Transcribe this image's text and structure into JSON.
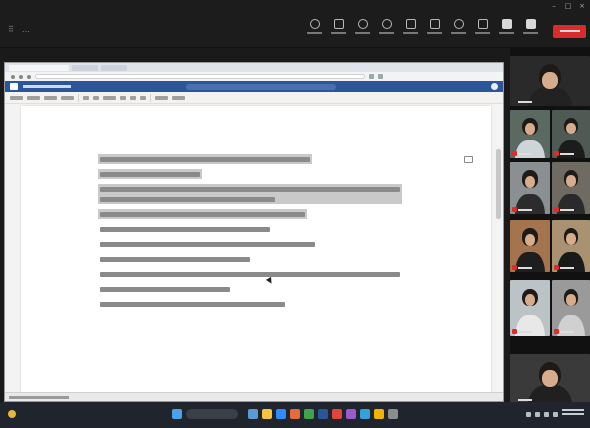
{
  "app": {
    "title": ""
  },
  "toolbar": {
    "tools": [
      {
        "id": "view"
      },
      {
        "id": "people"
      },
      {
        "id": "raise"
      },
      {
        "id": "react"
      },
      {
        "id": "view2"
      },
      {
        "id": "more"
      },
      {
        "id": "share"
      },
      {
        "id": "record"
      },
      {
        "id": "apps"
      },
      {
        "id": "more2"
      }
    ],
    "camera_label": "",
    "mic_label": "",
    "share_label": "",
    "leave_label": "",
    "leave_color": "#d92d2d"
  },
  "document": {
    "app_color": "#2b579a",
    "highlight_color": "#c9c9c9",
    "section_heading": "",
    "questions": [
      {
        "number": "",
        "text": "",
        "highlighted": true
      },
      {
        "number": "",
        "text": "",
        "highlighted": true
      },
      {
        "number": "",
        "text": "",
        "highlighted": true
      },
      {
        "number": "",
        "text": "",
        "highlighted": true
      },
      {
        "number": "",
        "text": "",
        "highlighted": false
      },
      {
        "number": "",
        "text": "",
        "highlighted": false
      },
      {
        "number": "",
        "text": "",
        "highlighted": false
      },
      {
        "number": "",
        "text": "",
        "highlighted": false
      },
      {
        "number": "",
        "text": "",
        "highlighted": false
      },
      {
        "number": "",
        "text": "",
        "highlighted": false
      }
    ]
  },
  "participants": [
    {
      "name": "",
      "muted": false
    },
    {
      "name": "",
      "muted": true
    },
    {
      "name": "",
      "muted": true
    },
    {
      "name": "",
      "muted": true
    },
    {
      "name": "",
      "muted": true
    },
    {
      "name": "",
      "muted": true
    },
    {
      "name": "",
      "muted": true
    },
    {
      "name": "",
      "muted": true
    },
    {
      "name": "",
      "muted": true
    },
    {
      "name": "",
      "muted": false
    }
  ],
  "taskbar": {
    "search_placeholder": ""
  }
}
